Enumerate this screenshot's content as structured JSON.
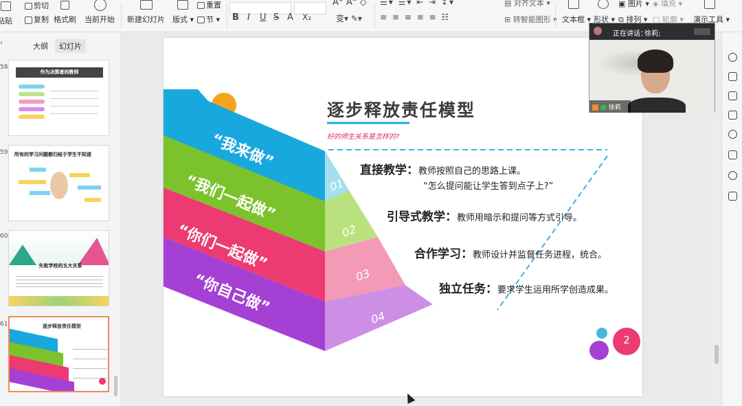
{
  "ribbon": {
    "cut": "剪切",
    "paste": "粘贴",
    "copy": "复制",
    "format_painter": "格式刷",
    "start_from_current": "当前开始",
    "new_slide": "新建幻灯片",
    "layout": "版式",
    "section": "节",
    "reset": "重置",
    "align_text": "对齐文本",
    "smart_graphic": "转智能图形",
    "textbox": "文本框",
    "shape": "形状",
    "arrange": "排列",
    "picture": "图片",
    "fill": "填充",
    "outline": "轮廓",
    "presentation_tools": "演示工具",
    "bold": "B",
    "italic": "I",
    "underline": "U",
    "strike": "S",
    "font_color": "A",
    "subscript": "X₂"
  },
  "left_panel": {
    "tab_outline": "大纲",
    "tab_slides": "幻灯片",
    "thumbs": [
      {
        "num": "58",
        "title": "作为决策者的教师"
      },
      {
        "num": "59",
        "title": "所有的学习问题都归结于学生不知道"
      },
      {
        "num": "60",
        "title": "失败学校的五大关系"
      },
      {
        "num": "61",
        "title": "逐步释放责任模型"
      }
    ]
  },
  "slide": {
    "title": "逐步释放责任模型",
    "subtitle": "好的师生关系是怎样的?",
    "steps": [
      {
        "label": "“我来做”",
        "num": "01",
        "color": "#19a8dd",
        "side": "#a4dff0"
      },
      {
        "label": "“我们一起做”",
        "num": "02",
        "color": "#7cc22c",
        "side": "#b9e27e"
      },
      {
        "label": "“你们一起做”",
        "num": "03",
        "color": "#ec3a72",
        "side": "#f39ab7"
      },
      {
        "label": "“你自己做”",
        "num": "04",
        "color": "#a540d4",
        "side": "#cd8fe6"
      }
    ],
    "items": [
      {
        "head": "直接教学：",
        "text": "教师按照自己的思路上课。"
      },
      {
        "head": "",
        "text": "“怎么提问能让学生答到点子上?”"
      },
      {
        "head": "引导式教学：",
        "text": "教师用暗示和提问等方式引导。"
      },
      {
        "head": "合作学习：",
        "text": "教师设计并监督任务进程，统合。"
      },
      {
        "head": "独立任务：",
        "text": "要求学生运用所学创造成果。"
      }
    ],
    "page_badge": "2"
  },
  "video": {
    "status": "正在讲话：",
    "speaker": "徐莉;",
    "name_tag": "徐莉"
  },
  "colors": {
    "accent": "#f08a5d",
    "blue": "#19a8dd",
    "green": "#7cc22c",
    "pink": "#ec3a72",
    "purple": "#a540d4"
  }
}
